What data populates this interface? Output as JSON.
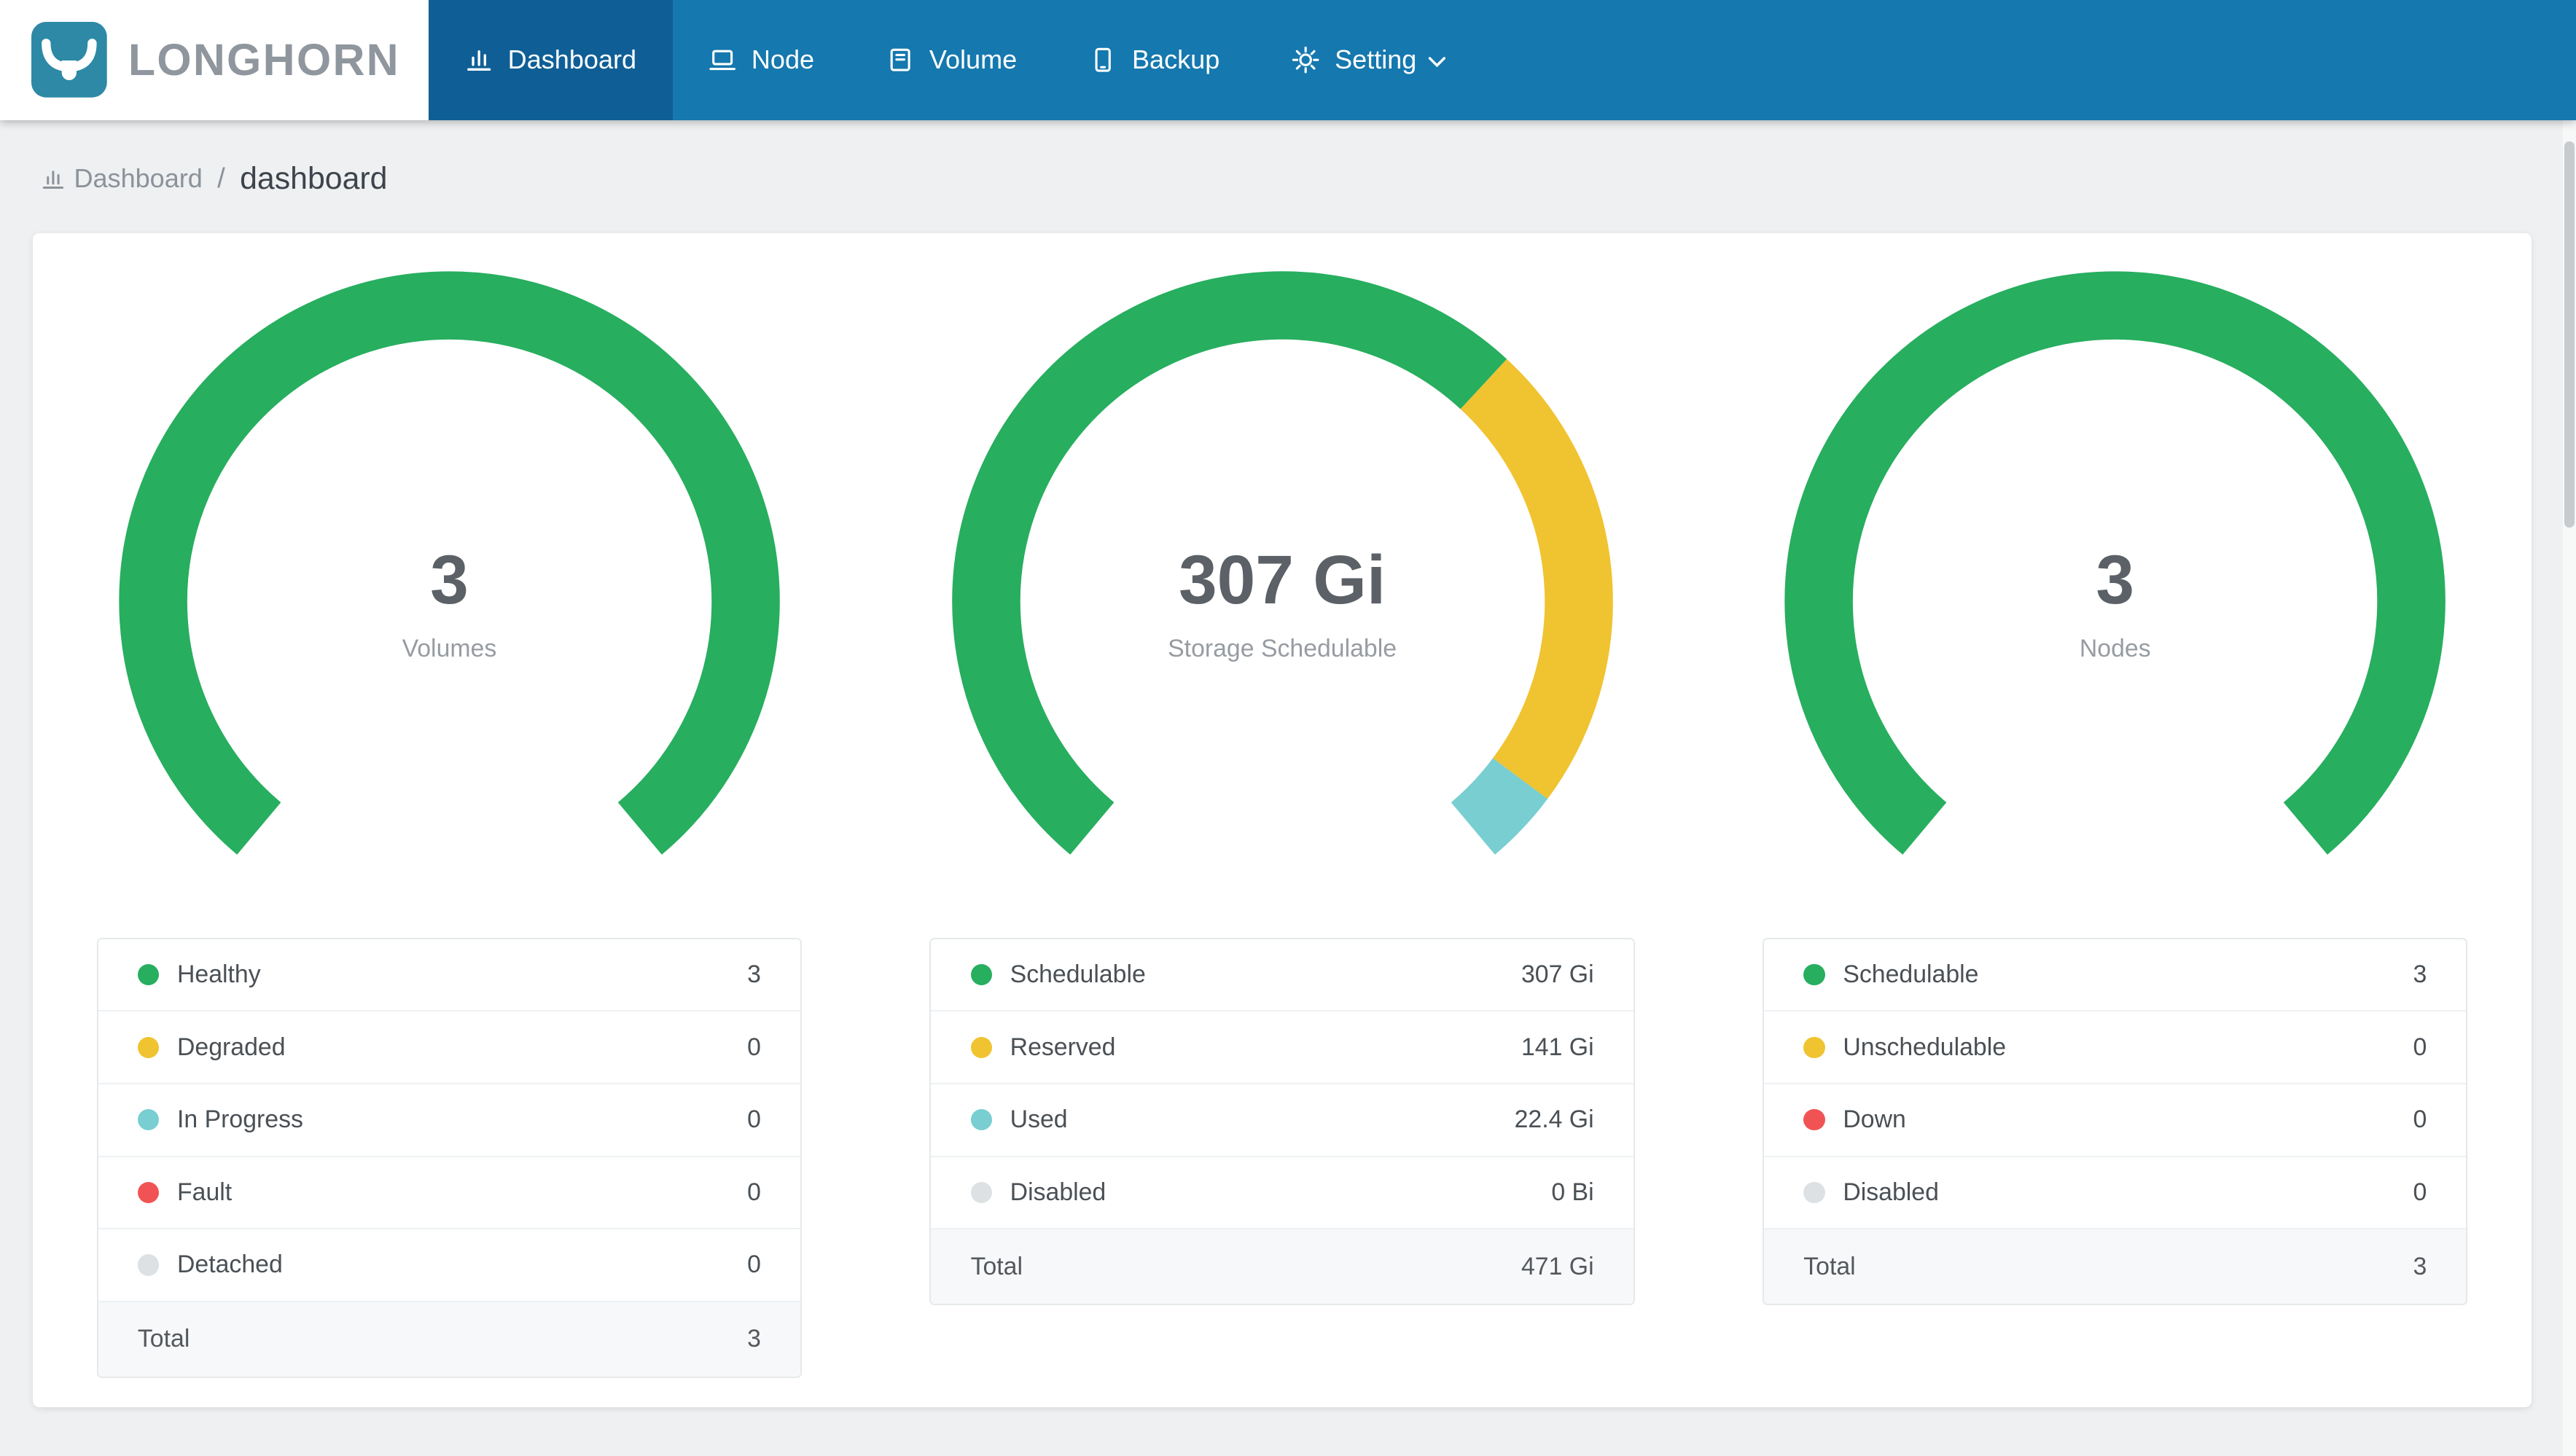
{
  "brand": {
    "name": "LONGHORN"
  },
  "nav": {
    "items": [
      {
        "label": "Dashboard",
        "icon": "bar-chart-icon",
        "active": true
      },
      {
        "label": "Node",
        "icon": "node-icon",
        "active": false
      },
      {
        "label": "Volume",
        "icon": "volume-icon",
        "active": false
      },
      {
        "label": "Backup",
        "icon": "backup-icon",
        "active": false
      },
      {
        "label": "Setting",
        "icon": "gear-icon",
        "active": false,
        "has_dropdown": true
      }
    ]
  },
  "breadcrumb": {
    "section": "Dashboard",
    "separator": "/",
    "page": "dashboard"
  },
  "colors": {
    "navbar": "#1578AE",
    "navbar_active": "#0F5F96",
    "logo_teal": "#2D89A5",
    "green": "#27AE5F",
    "yellow": "#F0C330",
    "teal": "#78CED0",
    "red": "#F15354",
    "gray": "#DEE1E3",
    "background": "#EEF0F2"
  },
  "chart_data": [
    {
      "type": "donut-gauge",
      "title": "Volumes",
      "center_value": "3",
      "center_label": "Volumes",
      "total_label": "Total",
      "total_value": "3",
      "segments": [
        {
          "label": "Healthy",
          "value": 3,
          "display": "3",
          "color": "#27AE5F"
        },
        {
          "label": "Degraded",
          "value": 0,
          "display": "0",
          "color": "#F0C330"
        },
        {
          "label": "In Progress",
          "value": 0,
          "display": "0",
          "color": "#78CED0"
        },
        {
          "label": "Fault",
          "value": 0,
          "display": "0",
          "color": "#F15354"
        },
        {
          "label": "Detached",
          "value": 0,
          "display": "0",
          "color": "#DEE1E3"
        }
      ]
    },
    {
      "type": "donut-gauge",
      "title": "Storage Schedulable",
      "center_value": "307 Gi",
      "center_label": "Storage Schedulable",
      "total_label": "Total",
      "total_value": "471 Gi",
      "segments": [
        {
          "label": "Schedulable",
          "value": 307,
          "display": "307 Gi",
          "color": "#27AE5F"
        },
        {
          "label": "Reserved",
          "value": 141,
          "display": "141 Gi",
          "color": "#F0C330"
        },
        {
          "label": "Used",
          "value": 22.4,
          "display": "22.4 Gi",
          "color": "#78CED0"
        },
        {
          "label": "Disabled",
          "value": 0,
          "display": "0 Bi",
          "color": "#DEE1E3"
        }
      ]
    },
    {
      "type": "donut-gauge",
      "title": "Nodes",
      "center_value": "3",
      "center_label": "Nodes",
      "total_label": "Total",
      "total_value": "3",
      "segments": [
        {
          "label": "Schedulable",
          "value": 3,
          "display": "3",
          "color": "#27AE5F"
        },
        {
          "label": "Unschedulable",
          "value": 0,
          "display": "0",
          "color": "#F0C330"
        },
        {
          "label": "Down",
          "value": 0,
          "display": "0",
          "color": "#F15354"
        },
        {
          "label": "Disabled",
          "value": 0,
          "display": "0",
          "color": "#DEE1E3"
        }
      ]
    }
  ]
}
